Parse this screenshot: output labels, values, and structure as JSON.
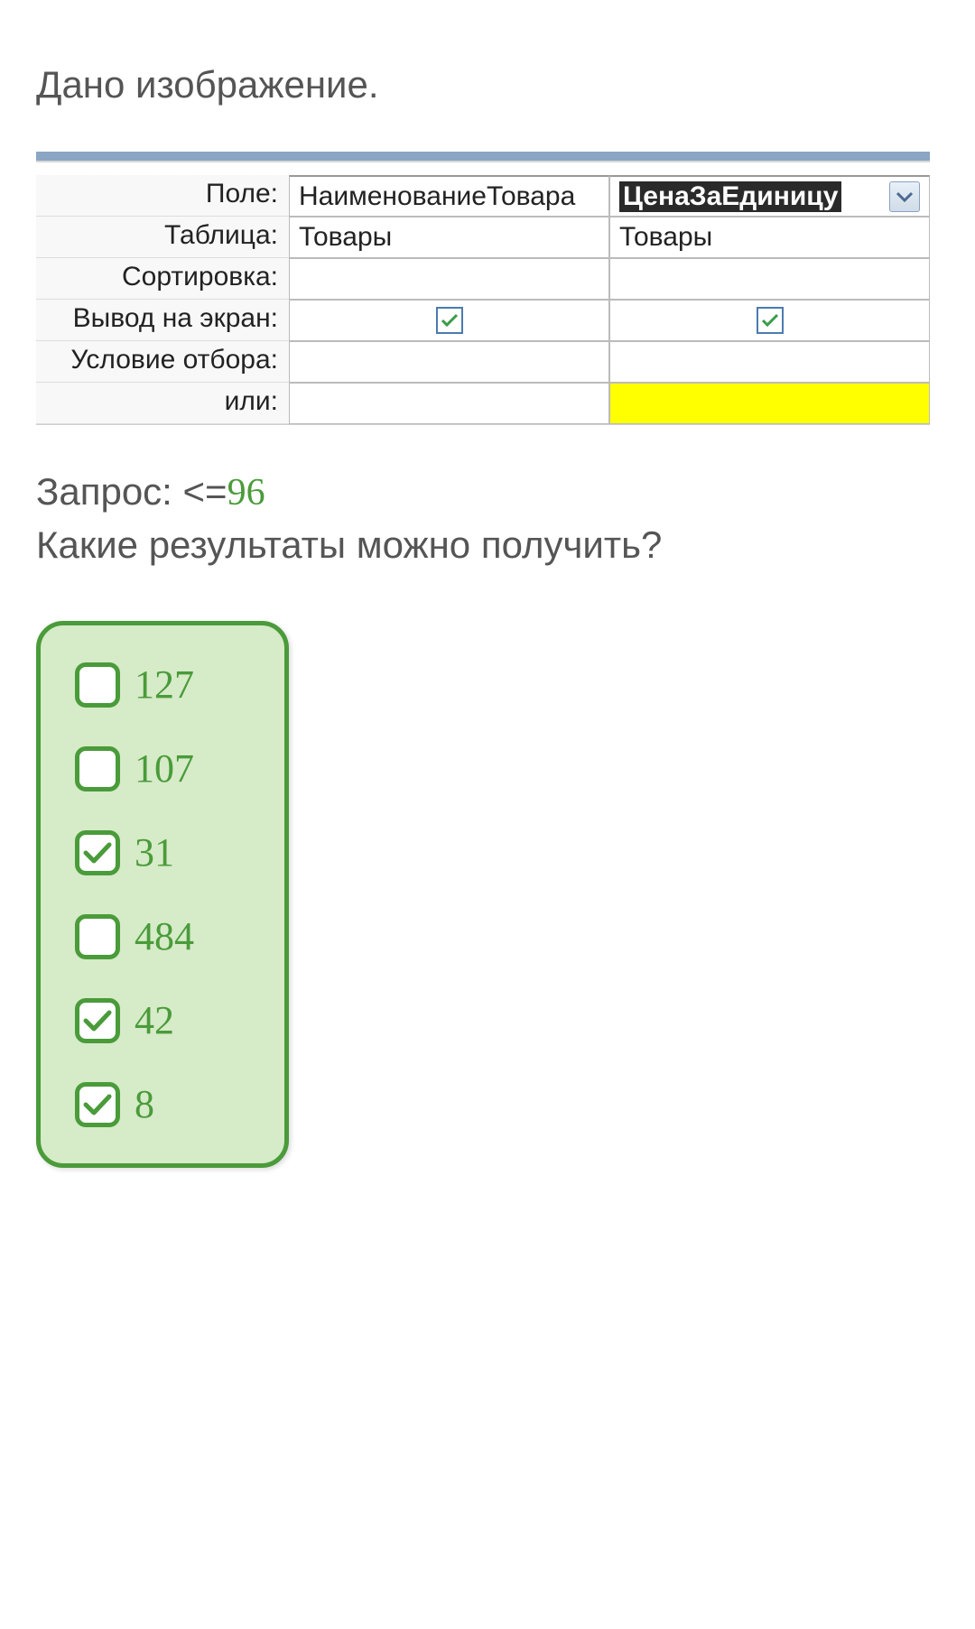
{
  "intro": "Дано изображение.",
  "gridLabels": {
    "field": "Поле:",
    "table": "Таблица:",
    "sort": "Сортировка:",
    "show": "Вывод на экран:",
    "criteria": "Условие отбора:",
    "or": "или:"
  },
  "gridData": {
    "col1": {
      "field": "НаименованиеТовара",
      "table": "Товары"
    },
    "col2": {
      "field": "ЦенаЗаЕдиницу",
      "table": "Товары"
    }
  },
  "queryPrefix": "Запрос: <=",
  "queryValue": "96",
  "question": "Какие результаты можно получить?",
  "options": [
    {
      "label": "127",
      "checked": false
    },
    {
      "label": "107",
      "checked": false
    },
    {
      "label": "31",
      "checked": true
    },
    {
      "label": "484",
      "checked": false
    },
    {
      "label": "42",
      "checked": true
    },
    {
      "label": "8",
      "checked": true
    }
  ]
}
